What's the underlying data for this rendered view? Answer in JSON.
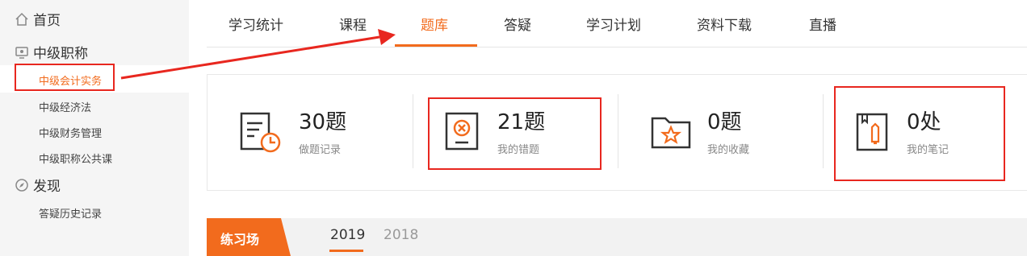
{
  "sidebar": {
    "home_label": "首页",
    "section_title": "中级职称",
    "items": [
      {
        "label": "中级会计实务",
        "active": true
      },
      {
        "label": "中级经济法",
        "active": false
      },
      {
        "label": "中级财务管理",
        "active": false
      },
      {
        "label": "中级职称公共课",
        "active": false
      }
    ],
    "discover_title": "发现",
    "discover_items": [
      {
        "label": "答疑历史记录"
      }
    ]
  },
  "tabs": [
    {
      "label": "学习统计"
    },
    {
      "label": "课程"
    },
    {
      "label": "题库",
      "active": true
    },
    {
      "label": "答疑"
    },
    {
      "label": "学习计划"
    },
    {
      "label": "资料下载"
    },
    {
      "label": "直播"
    }
  ],
  "stats": [
    {
      "value": "30题",
      "label": "做题记录",
      "icon": "practice-record-icon"
    },
    {
      "value": "21题",
      "label": "我的错题",
      "icon": "wrong-questions-icon"
    },
    {
      "value": "0题",
      "label": "我的收藏",
      "icon": "favorites-folder-icon"
    },
    {
      "value": "0处",
      "label": "我的笔记",
      "icon": "notes-book-icon"
    }
  ],
  "practice": {
    "label": "练习场",
    "years": [
      {
        "label": "2019",
        "active": true
      },
      {
        "label": "2018",
        "active": false
      }
    ]
  },
  "colors": {
    "accent": "#f26b1d",
    "annotation": "#e8271f"
  }
}
